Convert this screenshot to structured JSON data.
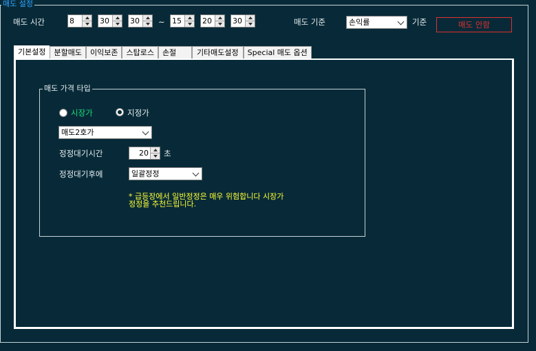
{
  "section": {
    "legend": "매도 설정"
  },
  "sell_time": {
    "label": "매도 시간",
    "start": {
      "hour": "8",
      "minute": "30",
      "second": "30"
    },
    "separator": "~",
    "end": {
      "hour": "15",
      "minute": "20",
      "second": "30"
    }
  },
  "sell_criteria": {
    "label": "매도 기준",
    "selected": "손익률",
    "suffix": "기준"
  },
  "sell_disable_button": "매도 안함",
  "tabs": [
    {
      "label": "기본설정",
      "active": true
    },
    {
      "label": "분할매도"
    },
    {
      "label": "이익보존"
    },
    {
      "label": "스탑로스"
    },
    {
      "label": "손절"
    },
    {
      "label": "기타매도설정"
    },
    {
      "label": "Special 매도 옵션"
    }
  ],
  "price_type": {
    "legend": "매도 가격 타입",
    "market_label": "시장가",
    "limit_label": "지정가",
    "selected_radio": "지정가",
    "price_select": "매도2호가",
    "correction_wait_label": "정정대기시간",
    "correction_wait_value": "20",
    "correction_wait_unit": "초",
    "after_wait_label": "정정대기후에",
    "after_wait_select": "일괄정정",
    "note_line1": "* 급등장에서 일반정정은 매우 위험합니다 시장가",
    "note_line2": "정정을 추천드립니다."
  },
  "colors": {
    "background": "#082a38",
    "accent_blue": "#2fa4ff",
    "market_green": "#19e07a",
    "warning_red": "#e03030",
    "note_yellow": "#ffff33"
  }
}
